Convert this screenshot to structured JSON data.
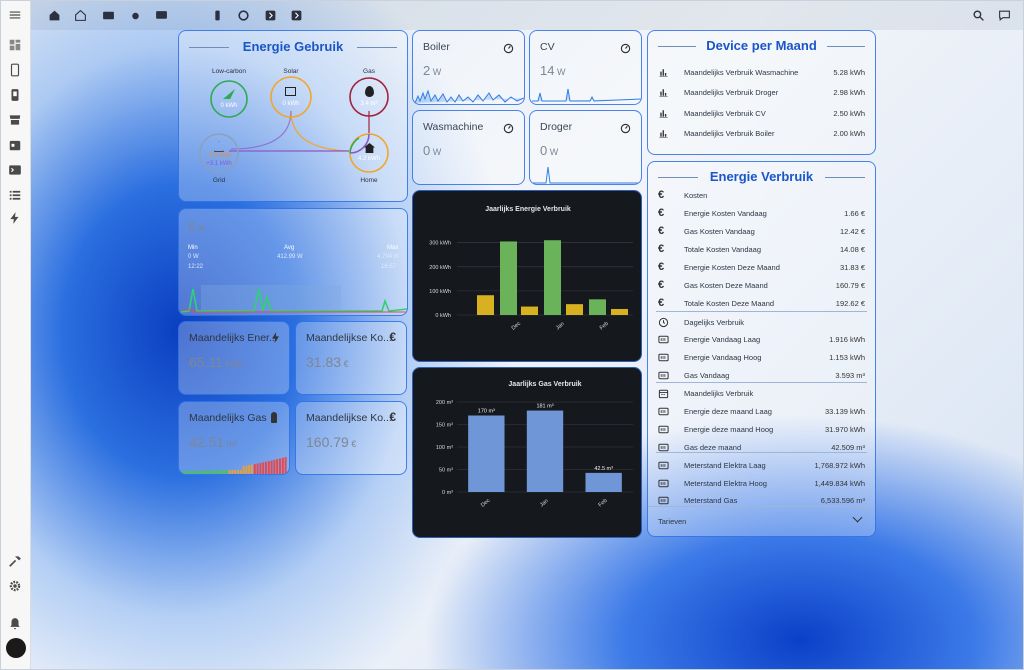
{
  "colors": {
    "accent": "#1a56c8",
    "border": "#2b6ee6",
    "green": "#6ab35a",
    "yellow": "#d7b11f",
    "gasbar": "#6f96d6"
  },
  "sidebar": {
    "items": [
      {
        "icon": "menu-icon"
      },
      {
        "icon": "dashboard-icon"
      },
      {
        "icon": "tablet-icon"
      },
      {
        "icon": "phone-icon"
      },
      {
        "icon": "store-icon"
      },
      {
        "icon": "calendar-icon"
      },
      {
        "icon": "terminal-icon"
      },
      {
        "icon": "list-icon"
      },
      {
        "icon": "lightning-icon"
      }
    ],
    "bottom": [
      {
        "icon": "hammer-icon"
      },
      {
        "icon": "settings-icon"
      },
      {
        "icon": "bell-icon"
      }
    ]
  },
  "topbar": {
    "tabs": [
      "home-1",
      "home-2",
      "appliance",
      "washer",
      "tv",
      "battery",
      "dryer",
      "arrow-1",
      "arrow-2"
    ]
  },
  "energie_gebruik": {
    "title": "Energie Gebruik",
    "low_carbon": {
      "label": "Low-carbon",
      "value": "0 kWh"
    },
    "solar": {
      "label": "Solar",
      "value": "0 kWh"
    },
    "gas": {
      "label": "Gas",
      "value": "3.4 m³"
    },
    "grid": {
      "label": "Grid",
      "in": "+0.8 kWh",
      "out": "+3.1 kWh"
    },
    "home": {
      "label": "Home",
      "value": "4.2 kWh"
    }
  },
  "power_graph": {
    "value": "6",
    "unit": "W",
    "min_label": "Min",
    "min_val": "0 W",
    "min_time": "12:22",
    "avg_label": "Avg",
    "avg_val": "412.99 W",
    "max_label": "Max",
    "max_val": "4,794 W",
    "max_time": "16:57"
  },
  "tiles": [
    {
      "name": "Maandelijks Ener...",
      "value": "65.11",
      "unit": "kWh"
    },
    {
      "name": "Maandelijkse Ko...",
      "value": "31.83",
      "unit": "€"
    },
    {
      "name": "Maandelijks Gas",
      "value": "42.51",
      "unit": "m³"
    },
    {
      "name": "Maandelijkse Ko...",
      "value": "160.79",
      "unit": "€"
    }
  ],
  "sensors": [
    {
      "name": "Boiler",
      "value": "2",
      "unit": "W"
    },
    {
      "name": "CV",
      "value": "14",
      "unit": "W"
    },
    {
      "name": "Wasmachine",
      "value": "0",
      "unit": "W"
    },
    {
      "name": "Droger",
      "value": "0",
      "unit": "W"
    }
  ],
  "chart_data": [
    {
      "type": "bar",
      "title": "Jaarlijks Energie Verbruik",
      "categories": [
        "Dec",
        "Jan",
        "Feb"
      ],
      "series": [
        {
          "values": [
            82,
            310,
            65
          ]
        },
        {
          "values": [
            35,
            305,
            30
          ]
        }
      ],
      "ytick_labels": [
        "0 kWh",
        "100 kWh",
        "200 kWh",
        "300 kWh"
      ],
      "yticks": [
        0,
        100,
        200,
        300
      ],
      "ylim": [
        0,
        340
      ],
      "grid": true
    },
    {
      "type": "bar",
      "title": "Jaarlijks Gas Verbruik",
      "categories": [
        "Dec",
        "Jan",
        "Feb"
      ],
      "values": [
        170,
        181,
        42.5
      ],
      "data_labels": [
        "170 m³",
        "181 m³",
        "42.5 m³"
      ],
      "ytick_labels": [
        "0 m³",
        "50 m³",
        "100 m³",
        "150 m³",
        "200 m³"
      ],
      "yticks": [
        0,
        50,
        100,
        150,
        200
      ],
      "ylim": [
        0,
        200
      ],
      "grid": true
    }
  ],
  "device_per_maand": {
    "title": "Device per Maand",
    "rows": [
      {
        "label": "Maandelijks Verbruik Wasmachine",
        "value": "5.28 kWh"
      },
      {
        "label": "Maandelijks Verbruik Droger",
        "value": "2.98 kWh"
      },
      {
        "label": "Maandelijks Verbruik CV",
        "value": "2.50 kWh"
      },
      {
        "label": "Maandelijks Verbruik Boiler",
        "value": "2.00 kWh"
      }
    ]
  },
  "energie_verbruik": {
    "title": "Energie Verbruik",
    "rows": [
      {
        "icon": "euro-icon",
        "label": "Kosten",
        "value": ""
      },
      {
        "icon": "euro-icon",
        "label": "Energie Kosten Vandaag",
        "value": "1.66 €"
      },
      {
        "icon": "euro-icon",
        "label": "Gas Kosten Vandaag",
        "value": "12.42 €"
      },
      {
        "icon": "euro-icon",
        "label": "Totale Kosten Vandaag",
        "value": "14.08 €"
      },
      {
        "icon": "euro-icon",
        "label": "Energie Kosten Deze Maand",
        "value": "31.83 €"
      },
      {
        "icon": "euro-icon",
        "label": "Gas Kosten Deze Maand",
        "value": "160.79 €"
      },
      {
        "icon": "euro-icon",
        "label": "Totale Kosten Deze Maand",
        "value": "192.62 €"
      },
      {
        "icon": "clock-icon",
        "label": "Dagelijks Verbruik",
        "value": ""
      },
      {
        "icon": "meter-icon",
        "label": "Energie Vandaag Laag",
        "value": "1.916 kWh"
      },
      {
        "icon": "meter-icon",
        "label": "Energie Vandaag Hoog",
        "value": "1.153 kWh"
      },
      {
        "icon": "meter-icon",
        "label": "Gas Vandaag",
        "value": "3.593 m³"
      },
      {
        "icon": "calendar-icon",
        "label": "Maandelijks Verbruik",
        "value": ""
      },
      {
        "icon": "meter-icon",
        "label": "Energie deze maand Laag",
        "value": "33.139 kWh"
      },
      {
        "icon": "meter-icon",
        "label": "Energie deze maand Hoog",
        "value": "31.970 kWh"
      },
      {
        "icon": "meter-icon",
        "label": "Gas deze maand",
        "value": "42.509 m³"
      },
      {
        "icon": "meter-icon",
        "label": "Meterstand Elektra Laag",
        "value": "1,768.972 kWh"
      },
      {
        "icon": "meter-icon",
        "label": "Meterstand Elektra Hoog",
        "value": "1,449.834 kWh"
      },
      {
        "icon": "meter-icon",
        "label": "Meterstand Gas",
        "value": "6,533.596 m³"
      }
    ],
    "footer": "Tarieven"
  }
}
